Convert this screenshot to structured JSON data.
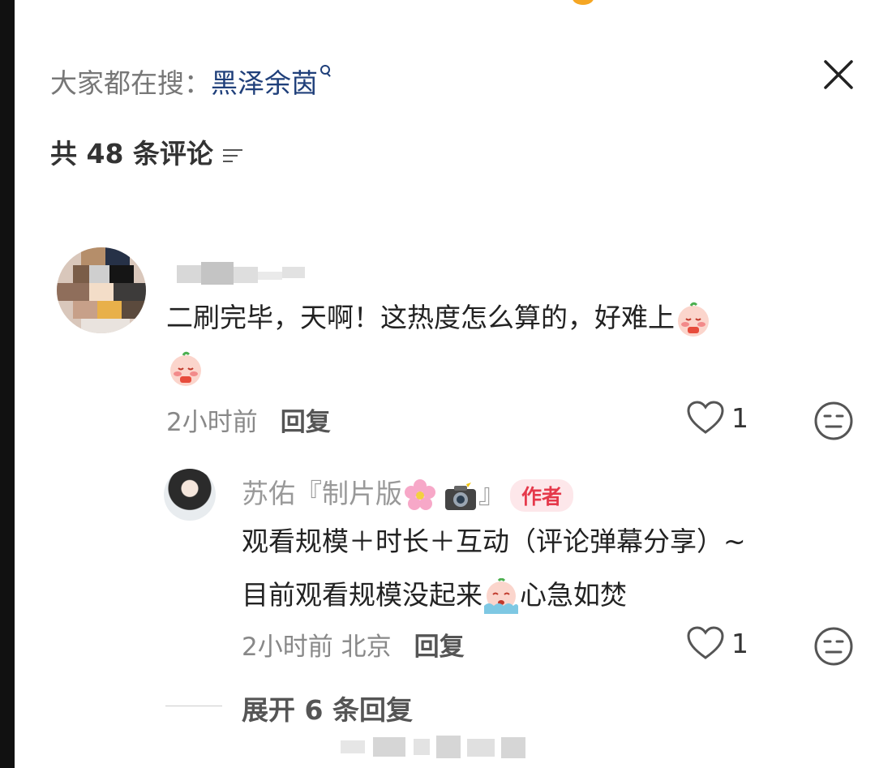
{
  "search_hint": {
    "prefix": "大家都在搜：",
    "keyword": "黑泽余茵"
  },
  "comment_count_label": "共 48 条评论",
  "comment": {
    "text_line1": "二刷完毕，天啊！这热度怎么算的，好难上",
    "time": "2小时前",
    "reply_label": "回复",
    "like_count": "1"
  },
  "reply": {
    "author_name": "苏佑『制片版",
    "author_name_suffix": "』",
    "author_badge": "作者",
    "text_line1": "观看规模＋时长＋互动（评论弹幕分享）~",
    "text_line2_a": "目前观看规模没起来",
    "text_line2_b": "心急如焚",
    "time": "2小时前",
    "location": "北京",
    "reply_label": "回复",
    "like_count": "1"
  },
  "expand_replies_label": "展开 6 条回复",
  "colors": {
    "link_blue": "#1f3f7a",
    "author_badge_red": "#e5394b",
    "author_badge_bg": "#fde7ea",
    "muted_text": "#888888"
  },
  "icons": [
    "close-icon",
    "sort-icon",
    "heart-icon",
    "dislike-face-icon",
    "search-icon",
    "flower-emoji",
    "camera-flash-emoji",
    "blushing-face-emoji",
    "crying-face-emoji"
  ]
}
